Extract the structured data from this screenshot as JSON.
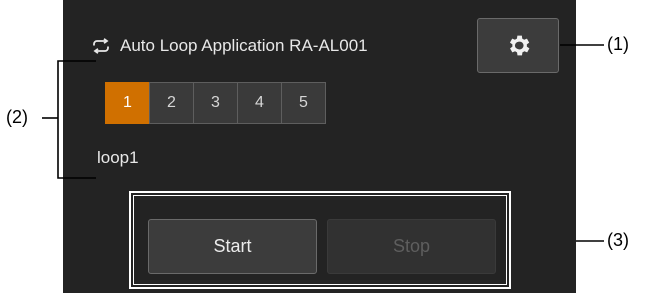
{
  "app": {
    "title": "Auto Loop Application RA-AL001",
    "title_icon": "loop-arrows-icon"
  },
  "settings_button": {
    "icon": "gear-icon"
  },
  "tabs": [
    {
      "label": "1",
      "active": true
    },
    {
      "label": "2",
      "active": false
    },
    {
      "label": "3",
      "active": false
    },
    {
      "label": "4",
      "active": false
    },
    {
      "label": "5",
      "active": false
    }
  ],
  "loop_name": "loop1",
  "controls": {
    "start_label": "Start",
    "stop_label": "Stop",
    "stop_enabled": false
  },
  "callouts": {
    "c1": "(1)",
    "c2": "(2)",
    "c3": "(3)"
  },
  "colors": {
    "panel_bg": "#232323",
    "accent_active_tab": "#d07000",
    "button_bg": "#3c3c3c"
  }
}
